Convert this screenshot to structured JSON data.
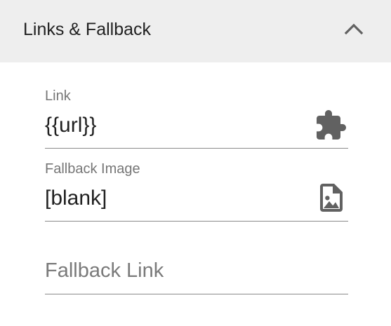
{
  "section": {
    "title": "Links & Fallback",
    "collapse_icon": "chevron-up-icon",
    "expanded": true
  },
  "fields": {
    "link": {
      "label": "Link",
      "value": "{{url}}",
      "icon": "puzzle-piece-icon"
    },
    "fallback_image": {
      "label": "Fallback Image",
      "value": "[blank]",
      "icon": "image-file-icon"
    },
    "fallback_link": {
      "placeholder": "Fallback Link",
      "value": ""
    }
  },
  "colors": {
    "header_bg": "#eeeeee",
    "text_primary": "#212121",
    "text_secondary": "#767676",
    "icon": "#616161",
    "underline": "#8a8a8a"
  }
}
